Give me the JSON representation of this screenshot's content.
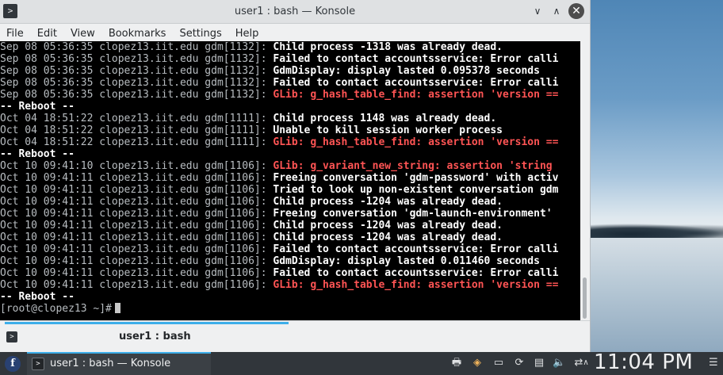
{
  "window": {
    "title": "user1 : bash — Konsole",
    "minimize_glyph": "∨",
    "maximize_glyph": "∧",
    "close_glyph": "✕",
    "app_icon": "terminal-icon"
  },
  "menubar": {
    "items": [
      "File",
      "Edit",
      "View",
      "Bookmarks",
      "Settings",
      "Help"
    ]
  },
  "terminal": {
    "lines": [
      {
        "ts": "Sep 08 05:36:35",
        "host": "clopez13.iit.edu",
        "proc": "gdm[1132]:",
        "msg": "Child process -1318 was already dead.",
        "err": false
      },
      {
        "ts": "Sep 08 05:36:35",
        "host": "clopez13.iit.edu",
        "proc": "gdm[1132]:",
        "msg": "Failed to contact accountsservice: Error calli",
        "err": false
      },
      {
        "ts": "Sep 08 05:36:35",
        "host": "clopez13.iit.edu",
        "proc": "gdm[1132]:",
        "msg": "GdmDisplay: display lasted 0.095378 seconds",
        "err": false
      },
      {
        "ts": "Sep 08 05:36:35",
        "host": "clopez13.iit.edu",
        "proc": "gdm[1132]:",
        "msg": "Failed to contact accountsservice: Error calli",
        "err": false
      },
      {
        "ts": "Sep 08 05:36:35",
        "host": "clopez13.iit.edu",
        "proc": "gdm[1132]:",
        "msg": "GLib: g_hash_table_find: assertion 'version ==",
        "err": true
      },
      {
        "reboot": "-- Reboot --"
      },
      {
        "ts": "Oct 04 18:51:22",
        "host": "clopez13.iit.edu",
        "proc": "gdm[1111]:",
        "msg": "Child process 1148 was already dead.",
        "err": false
      },
      {
        "ts": "Oct 04 18:51:22",
        "host": "clopez13.iit.edu",
        "proc": "gdm[1111]:",
        "msg": "Unable to kill session worker process",
        "err": false
      },
      {
        "ts": "Oct 04 18:51:22",
        "host": "clopez13.iit.edu",
        "proc": "gdm[1111]:",
        "msg": "GLib: g_hash_table_find: assertion 'version ==",
        "err": true
      },
      {
        "reboot": "-- Reboot --"
      },
      {
        "ts": "Oct 10 09:41:10",
        "host": "clopez13.iit.edu",
        "proc": "gdm[1106]:",
        "msg": "GLib: g_variant_new_string: assertion 'string",
        "err": true
      },
      {
        "ts": "Oct 10 09:41:11",
        "host": "clopez13.iit.edu",
        "proc": "gdm[1106]:",
        "msg": "Freeing conversation 'gdm-password' with activ",
        "err": false
      },
      {
        "ts": "Oct 10 09:41:11",
        "host": "clopez13.iit.edu",
        "proc": "gdm[1106]:",
        "msg": "Tried to look up non-existent conversation gdm",
        "err": false
      },
      {
        "ts": "Oct 10 09:41:11",
        "host": "clopez13.iit.edu",
        "proc": "gdm[1106]:",
        "msg": "Child process -1204 was already dead.",
        "err": false
      },
      {
        "ts": "Oct 10 09:41:11",
        "host": "clopez13.iit.edu",
        "proc": "gdm[1106]:",
        "msg": "Freeing conversation 'gdm-launch-environment'",
        "err": false
      },
      {
        "ts": "Oct 10 09:41:11",
        "host": "clopez13.iit.edu",
        "proc": "gdm[1106]:",
        "msg": "Child process -1204 was already dead.",
        "err": false
      },
      {
        "ts": "Oct 10 09:41:11",
        "host": "clopez13.iit.edu",
        "proc": "gdm[1106]:",
        "msg": "Child process -1204 was already dead.",
        "err": false
      },
      {
        "ts": "Oct 10 09:41:11",
        "host": "clopez13.iit.edu",
        "proc": "gdm[1106]:",
        "msg": "Failed to contact accountsservice: Error calli",
        "err": false
      },
      {
        "ts": "Oct 10 09:41:11",
        "host": "clopez13.iit.edu",
        "proc": "gdm[1106]:",
        "msg": "GdmDisplay: display lasted 0.011460 seconds",
        "err": false
      },
      {
        "ts": "Oct 10 09:41:11",
        "host": "clopez13.iit.edu",
        "proc": "gdm[1106]:",
        "msg": "Failed to contact accountsservice: Error calli",
        "err": false
      },
      {
        "ts": "Oct 10 09:41:11",
        "host": "clopez13.iit.edu",
        "proc": "gdm[1106]:",
        "msg": "GLib: g_hash_table_find: assertion 'version ==",
        "err": true
      },
      {
        "reboot": "-- Reboot --"
      }
    ],
    "prompt": "[root@clopez13 ~]#"
  },
  "tabbar": {
    "tab_label": "user1 : bash"
  },
  "panel": {
    "launcher_glyph": "f",
    "task_label": "user1 : bash — Konsole",
    "clock": "11:04 PM",
    "tray_icons": [
      "printer-icon",
      "package-updater-icon",
      "display-icon",
      "updates-icon",
      "clipboard-icon",
      "volume-icon",
      "network-icon",
      "expand-tray-icon"
    ],
    "tray_glyphs": [
      "🖶",
      "◈",
      "▭",
      "⟳",
      "▤",
      "🔈",
      "⇄",
      "∧"
    ],
    "grip_glyph": "☰"
  },
  "colors": {
    "terminal_bg": "#000000",
    "error_text": "#ff5454",
    "accent": "#3daee9",
    "panel_bg": "#31363b"
  }
}
